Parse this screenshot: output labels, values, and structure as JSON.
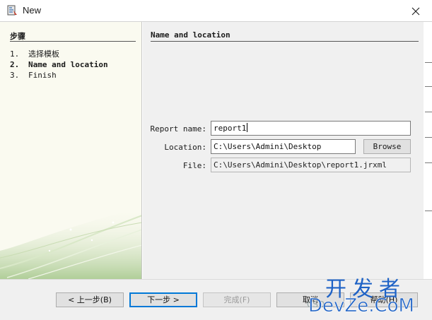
{
  "window": {
    "title": "New"
  },
  "steps_panel": {
    "heading": "步骤",
    "steps": [
      {
        "num": "1.",
        "label": "选择模板",
        "current": false
      },
      {
        "num": "2.",
        "label": "Name and location",
        "current": true
      },
      {
        "num": "3.",
        "label": "Finish",
        "current": false
      }
    ]
  },
  "content": {
    "heading": "Name and location",
    "report_name_label": "Report name:",
    "report_name_value": "report1",
    "location_label": "Location:",
    "location_value": "C:\\Users\\Admini\\Desktop",
    "browse_label": "Browse",
    "file_label": "File:",
    "file_value": "C:\\Users\\Admini\\Desktop\\report1.jrxml"
  },
  "buttons": {
    "back": "< 上一步(B)",
    "next": "下一步 >",
    "finish": "完成(F)",
    "cancel": "取消",
    "help": "帮助(H)"
  },
  "watermark": {
    "cn": "开发者",
    "en": "DevZe.CoM",
    "csdn": "CSD"
  },
  "colors": {
    "accent": "#0078d7",
    "watermark": "#1f63c6"
  }
}
